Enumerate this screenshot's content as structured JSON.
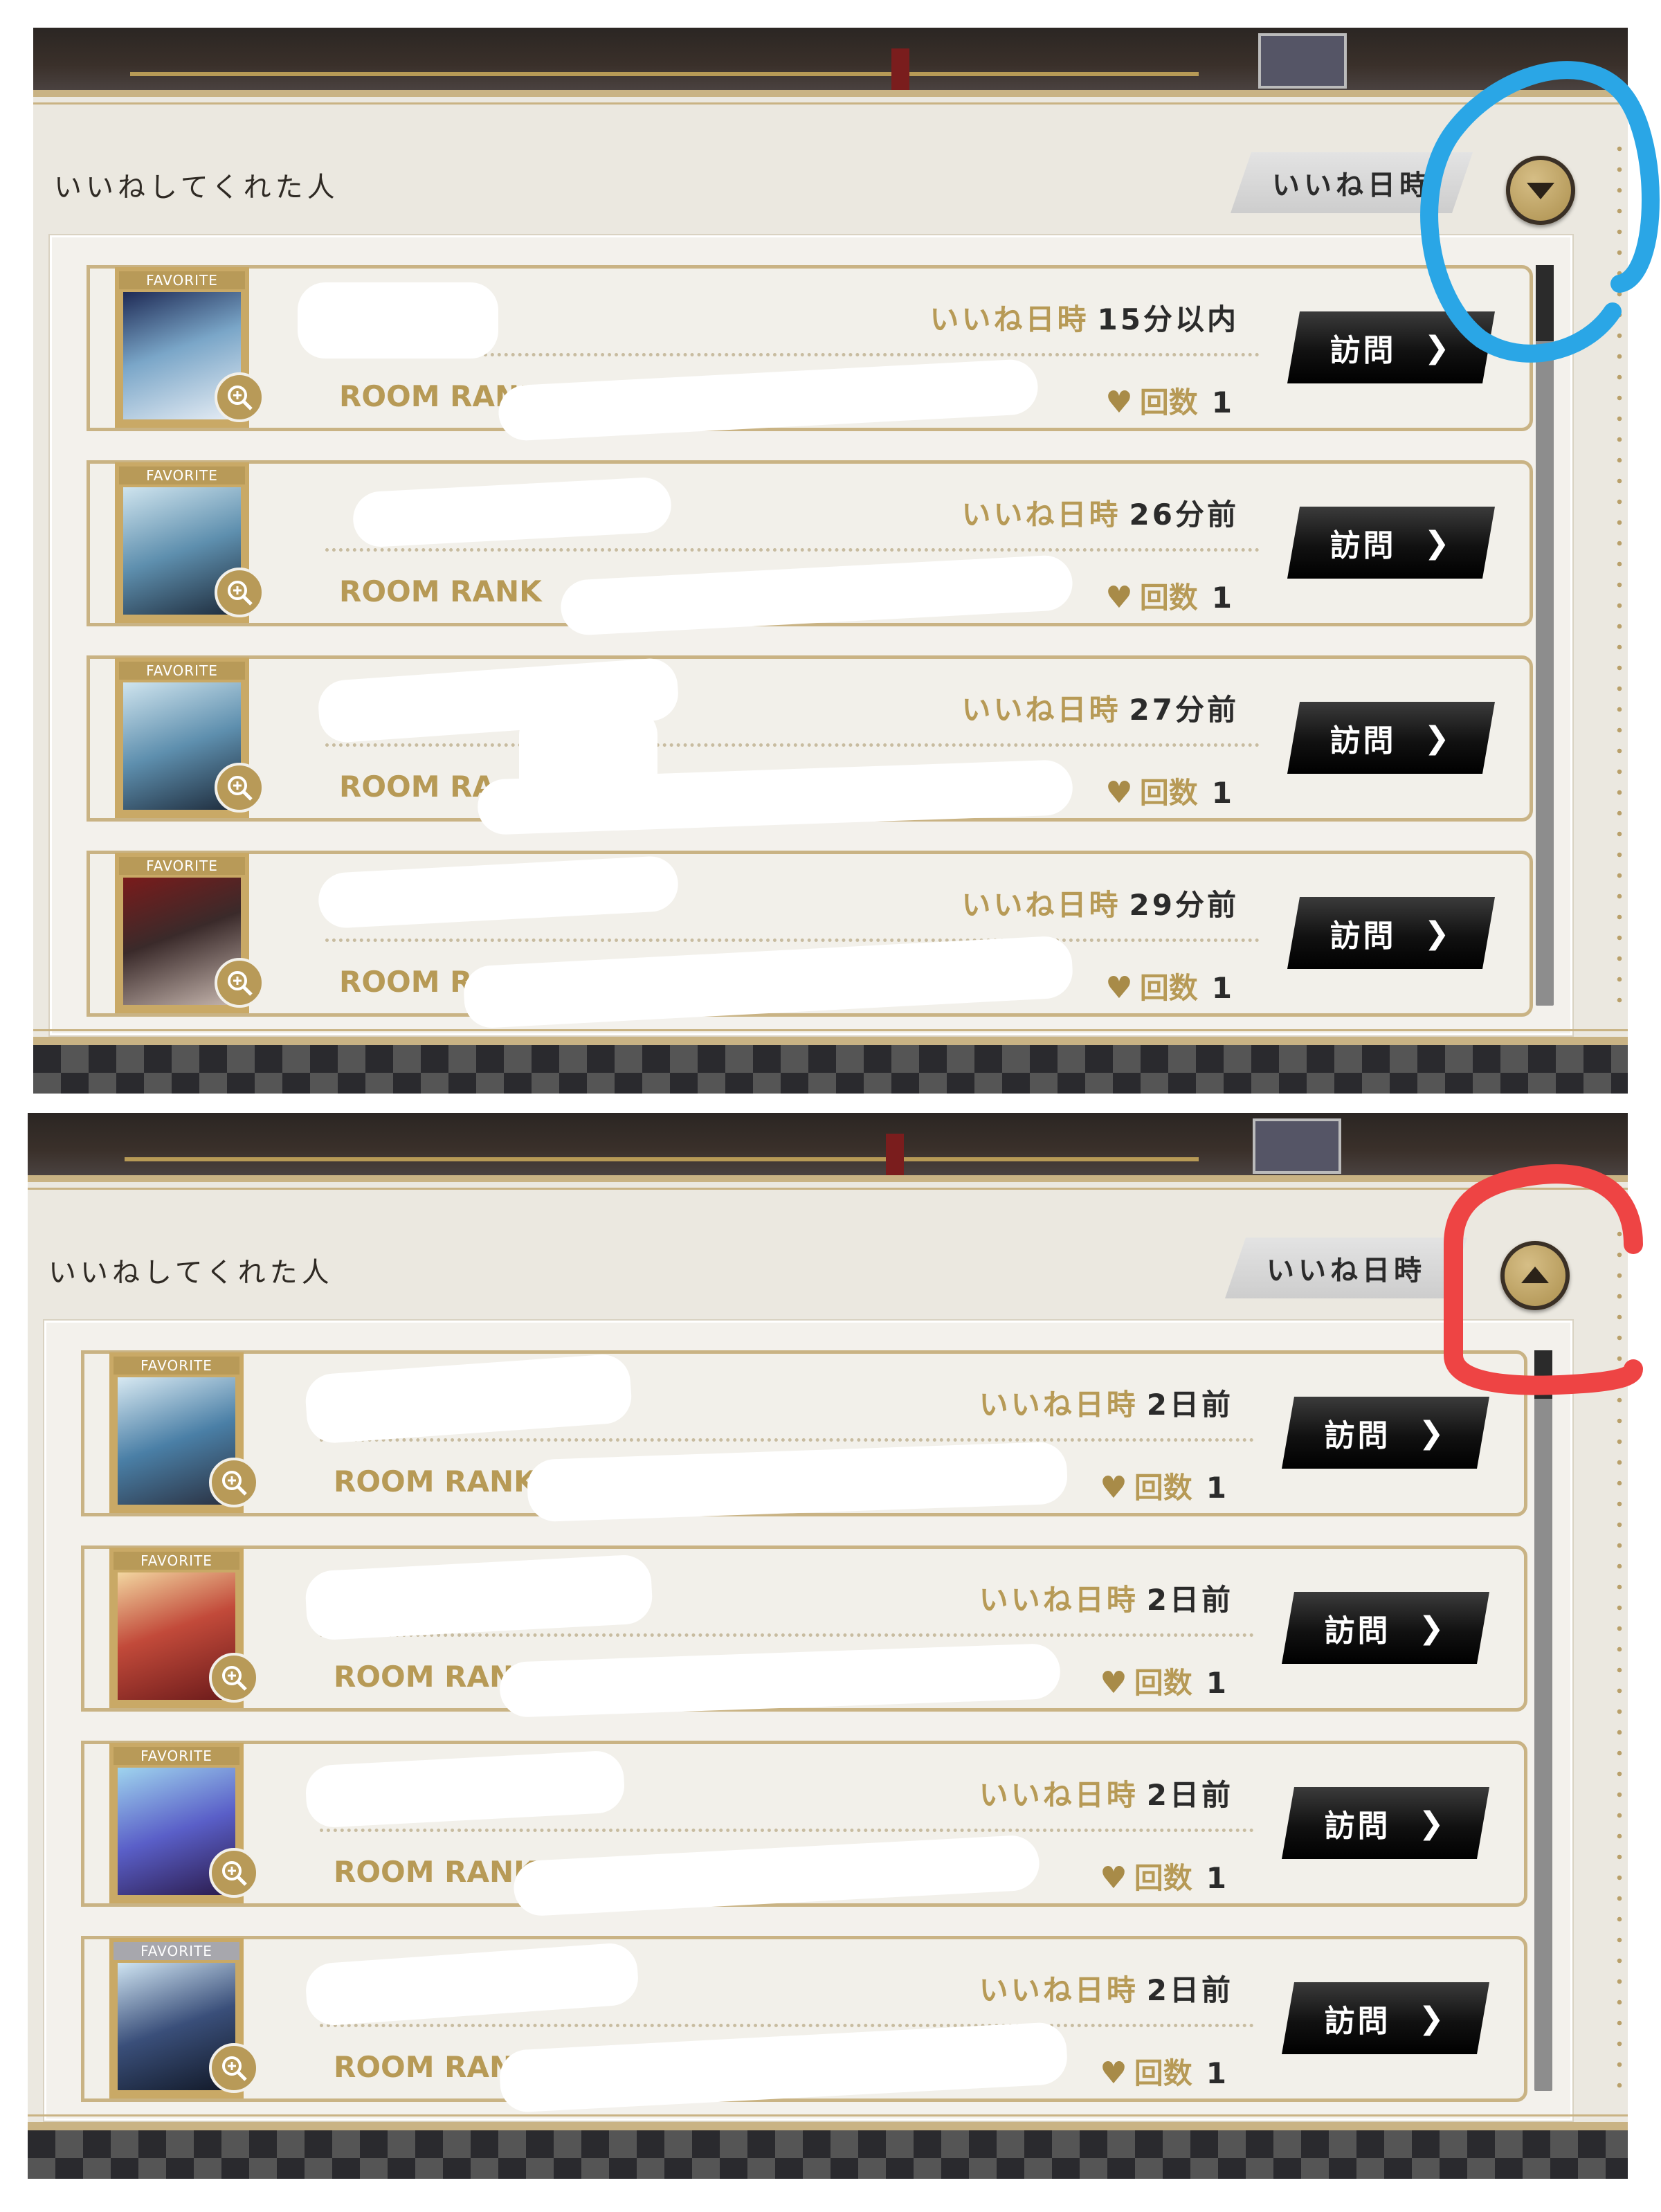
{
  "screenshots": [
    {
      "panel_title": "いいねしてくれた人",
      "sort_label": "いいね日時",
      "order_toggle": "descending",
      "annotation_color": "#2aa6e6",
      "rows": [
        {
          "favorite": "FAVORITE",
          "time_label": "いいね日時",
          "time_value": "15分以内",
          "rank_label": "ROOM RANK",
          "count_label": "回数",
          "count_value": "1",
          "visit_label": "訪問"
        },
        {
          "favorite": "FAVORITE",
          "time_label": "いいね日時",
          "time_value": "26分前",
          "rank_label": "ROOM RANK",
          "count_label": "回数",
          "count_value": "1",
          "visit_label": "訪問"
        },
        {
          "favorite": "FAVORITE",
          "time_label": "いいね日時",
          "time_value": "27分前",
          "rank_label": "ROOM RA",
          "count_label": "回数",
          "count_value": "1",
          "visit_label": "訪問"
        },
        {
          "favorite": "FAVORITE",
          "time_label": "いいね日時",
          "time_value": "29分前",
          "rank_label": "ROOM RA",
          "count_label": "回数",
          "count_value": "1",
          "visit_label": "訪問"
        }
      ]
    },
    {
      "panel_title": "いいねしてくれた人",
      "sort_label": "いいね日時",
      "order_toggle": "ascending",
      "annotation_color": "#ee4444",
      "rows": [
        {
          "favorite": "FAVORITE",
          "time_label": "いいね日時",
          "time_value": "2日前",
          "rank_label": "ROOM RANK",
          "count_label": "回数",
          "count_value": "1",
          "visit_label": "訪問"
        },
        {
          "favorite": "FAVORITE",
          "time_label": "いいね日時",
          "time_value": "2日前",
          "rank_label": "ROOM RAN",
          "count_label": "回数",
          "count_value": "1",
          "visit_label": "訪問"
        },
        {
          "favorite": "FAVORITE",
          "time_label": "いいね日時",
          "time_value": "2日前",
          "rank_label": "ROOM RANK",
          "count_label": "回数",
          "count_value": "1",
          "visit_label": "訪問"
        },
        {
          "favorite": "FAVORITE",
          "time_label": "いいね日時",
          "time_value": "2日前",
          "rank_label": "ROOM RAN",
          "count_label": "回数",
          "count_value": "1",
          "visit_label": "訪問"
        }
      ]
    }
  ],
  "portrait_colors": [
    "#7aa6c8",
    "#5e8fae",
    "#5e8fae",
    "#6b3b3b",
    "#4a7fa6",
    "#c24a3a",
    "#5a5fc8",
    "#3a4f7a"
  ]
}
